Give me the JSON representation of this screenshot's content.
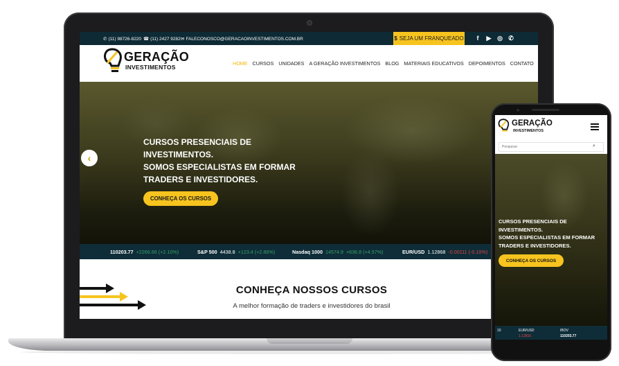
{
  "topbar": {
    "whatsapp": "(11) 98726-8220",
    "phone": "(11) 2427 9282",
    "email": "FALECONOSCO@GERACAOINVESTIMENTOS.COM.BR",
    "franchise_label": "SEJA UM FRANQUEADO",
    "social_icons": [
      "facebook-icon",
      "youtube-icon",
      "instagram-icon",
      "whatsapp-icon"
    ]
  },
  "brand": {
    "name": "GERAÇÃO",
    "sub": "INVESTIMENTOS",
    "accent": "#f7c41f",
    "dark": "#0e2d38"
  },
  "nav": {
    "items": [
      "HOME",
      "CURSOS",
      "UNIDADES",
      "A GERAÇÃO INVESTIMENTOS",
      "BLOG",
      "MATERIAIS EDUCATIVOS",
      "DEPOIMENTOS",
      "CONTATO"
    ],
    "active": "HOME"
  },
  "hero": {
    "line1": "CURSOS PRESENCIAIS DE",
    "line2": "INVESTIMENTOS.",
    "line3": "SOMOS ESPECIALISTAS EM FORMAR",
    "line4": "TRADERS E INVESTIDORES.",
    "button": "CONHEÇA OS CURSOS",
    "prev": "‹"
  },
  "ticker": [
    {
      "sym": "",
      "value": "110203.77",
      "change": "+2266.66 (+2.10%)",
      "dir": "up"
    },
    {
      "sym": "S&P 500",
      "value": "4438.8",
      "change": "+123.4 (+2.86%)",
      "dir": "up"
    },
    {
      "sym": "Nasdaq 1000",
      "value": "14574.9",
      "change": "+636.8 (+4.57%)",
      "dir": "up"
    },
    {
      "sym": "EUR/USD",
      "value": "1.12868",
      "change": "-0.00111 (-0.10%)",
      "dir": "down"
    }
  ],
  "courses": {
    "title": "CONHEÇA NOSSOS CURSOS",
    "subtitle": "A melhor formação de traders e investidores do brasil"
  },
  "mobile": {
    "search_placeholder": "Pesquisar",
    "hero_line1": "CURSOS PRESENCIAIS DE",
    "hero_line2": "INVESTIMENTOS.",
    "hero_line3": "SOMOS ESPECIALISTAS EM FORMAR",
    "hero_line4": "TRADERS E INVESTIDORES.",
    "button": "CONHEÇA OS CURSOS",
    "ticker": {
      "left_label": "10",
      "pair": "EUR/USD",
      "pair_value": "1.12816",
      "index": "IBOV",
      "index_value": "110203.77"
    }
  }
}
